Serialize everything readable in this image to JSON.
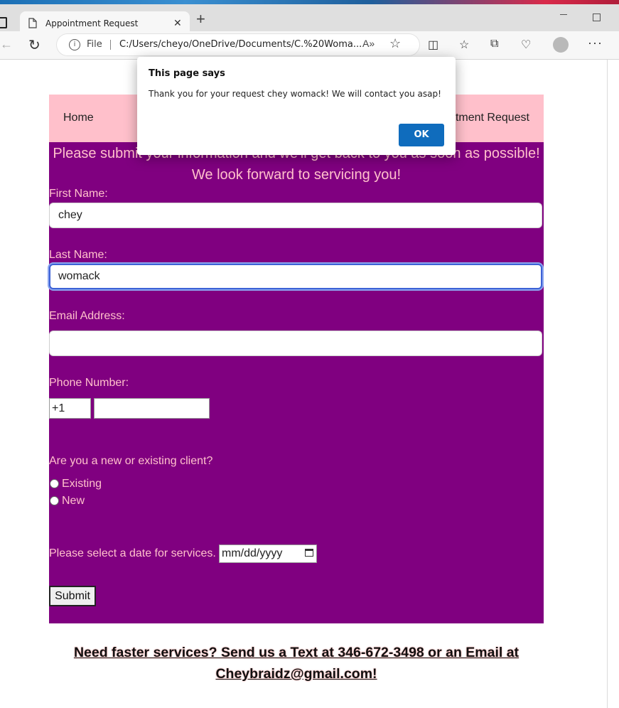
{
  "browser": {
    "tab_title": "Appointment Request",
    "address_scheme": "File",
    "address_url": "C:/Users/cheyo/OneDrive/Documents/C.%20Woma..."
  },
  "nav": {
    "home": "Home",
    "appointment_request": "tment Request"
  },
  "form": {
    "intro_line1": "Please submit your information and we'll get back to you as soon as possible!",
    "intro_line2": "We look forward to servicing you!",
    "first_name_label": "First Name:",
    "first_name_value": "chey",
    "last_name_label": "Last Name:",
    "last_name_value": "womack",
    "email_label": "Email Address:",
    "email_value": "",
    "phone_label": "Phone Number:",
    "phone_country_code": "+1",
    "phone_value": "",
    "client_question": "Are you a new or existing client?",
    "option_existing": "Existing",
    "option_new": "New",
    "date_label": "Please select a date for services.",
    "date_placeholder": "mm/dd/yyyy",
    "submit_label": "Submit"
  },
  "footer": {
    "line1": "Need faster services? Send us a Text at 346-672-3498 or an Email at",
    "line2": "Cheybraidz@gmail.com!"
  },
  "dialog": {
    "title": "This page says",
    "message": "Thank you for your request chey womack! We will contact you asap!",
    "ok_label": "OK"
  },
  "colors": {
    "nav_background": "#ffc0cb",
    "form_background": "#800080",
    "form_text": "#ffc0cb",
    "dialog_button": "#0f6cbd"
  }
}
